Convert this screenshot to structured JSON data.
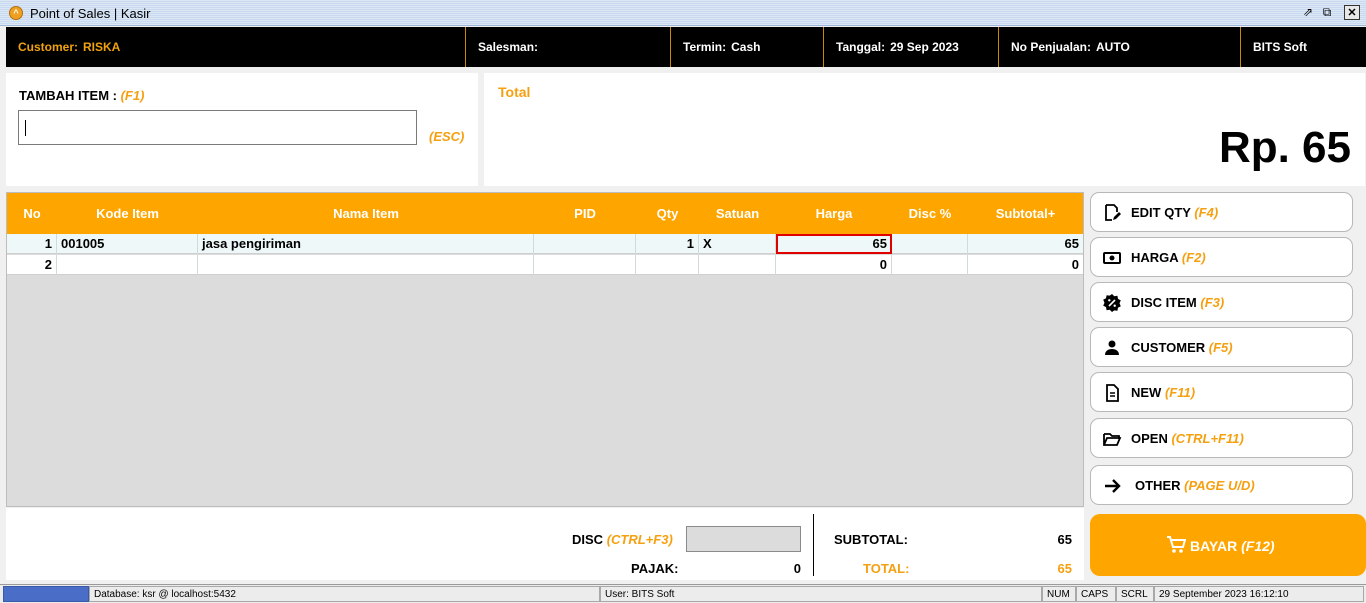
{
  "window": {
    "title": "Point of Sales | Kasir",
    "controls": {
      "restore": "⇗",
      "maximize": "⧉",
      "close": "✕"
    }
  },
  "header": {
    "customer_label": "Customer:",
    "customer_value": "RISKA",
    "salesman_label": "Salesman:",
    "salesman_value": "",
    "termin_label": "Termin:",
    "termin_value": "Cash",
    "tanggal_label": "Tanggal:",
    "tanggal_value": "29 Sep 2023",
    "nopenjualan_label": "No Penjualan:",
    "nopenjualan_value": "AUTO",
    "company": "BITS Soft"
  },
  "add_item": {
    "label": "TAMBAH ITEM :",
    "shortcut": "(F1)",
    "value": "",
    "esc_label": "(ESC)"
  },
  "total": {
    "label": "Total",
    "amount": "Rp. 65"
  },
  "grid": {
    "columns": [
      "No",
      "Kode Item",
      "Nama Item",
      "PID",
      "Qty",
      "Satuan",
      "Harga",
      "Disc %",
      "Subtotal+"
    ],
    "rows": [
      {
        "no": "1",
        "kode": "001005",
        "nama": "jasa pengiriman",
        "pid": "",
        "qty": "1",
        "satuan": "X",
        "harga": "65",
        "disc": "",
        "subtotal": "65"
      },
      {
        "no": "2",
        "kode": "",
        "nama": "",
        "pid": "",
        "qty": "",
        "satuan": "",
        "harga": "0",
        "disc": "",
        "subtotal": "0"
      }
    ]
  },
  "side_buttons": [
    {
      "label": "EDIT QTY",
      "shortcut": "(F4)",
      "icon": "edit-icon"
    },
    {
      "label": "HARGA",
      "shortcut": "(F2)",
      "icon": "money-icon"
    },
    {
      "label": "DISC ITEM",
      "shortcut": "(F3)",
      "icon": "discount-badge-icon"
    },
    {
      "label": "CUSTOMER",
      "shortcut": "(F5)",
      "icon": "person-icon"
    },
    {
      "label": "NEW",
      "shortcut": "(F11)",
      "icon": "document-icon"
    },
    {
      "label": "OPEN",
      "shortcut": "(CTRL+F11)",
      "icon": "folder-open-icon"
    },
    {
      "label": "OTHER",
      "shortcut": "(PAGE U/D)",
      "icon": "arrow-right-icon"
    }
  ],
  "bayar": {
    "label": "BAYAR",
    "shortcut": "(F12)",
    "icon": "cart-icon"
  },
  "footer": {
    "disc_label": "DISC",
    "disc_shortcut": "(CTRL+F3)",
    "disc_value": "",
    "pajak_label": "PAJAK:",
    "pajak_value": "0",
    "subtotal_label": "SUBTOTAL:",
    "subtotal_value": "65",
    "total_label": "TOTAL:",
    "total_value": "65"
  },
  "statusbar": {
    "database": "Database: ksr @ localhost:5432",
    "user": "User: BITS Soft",
    "num": "NUM",
    "caps": "CAPS",
    "scrl": "SCRL",
    "datetime": "29 September 2023  16:12:10"
  },
  "colors": {
    "accent": "#ffa500",
    "header_bg": "#000000",
    "highlight_border": "#e00000"
  }
}
